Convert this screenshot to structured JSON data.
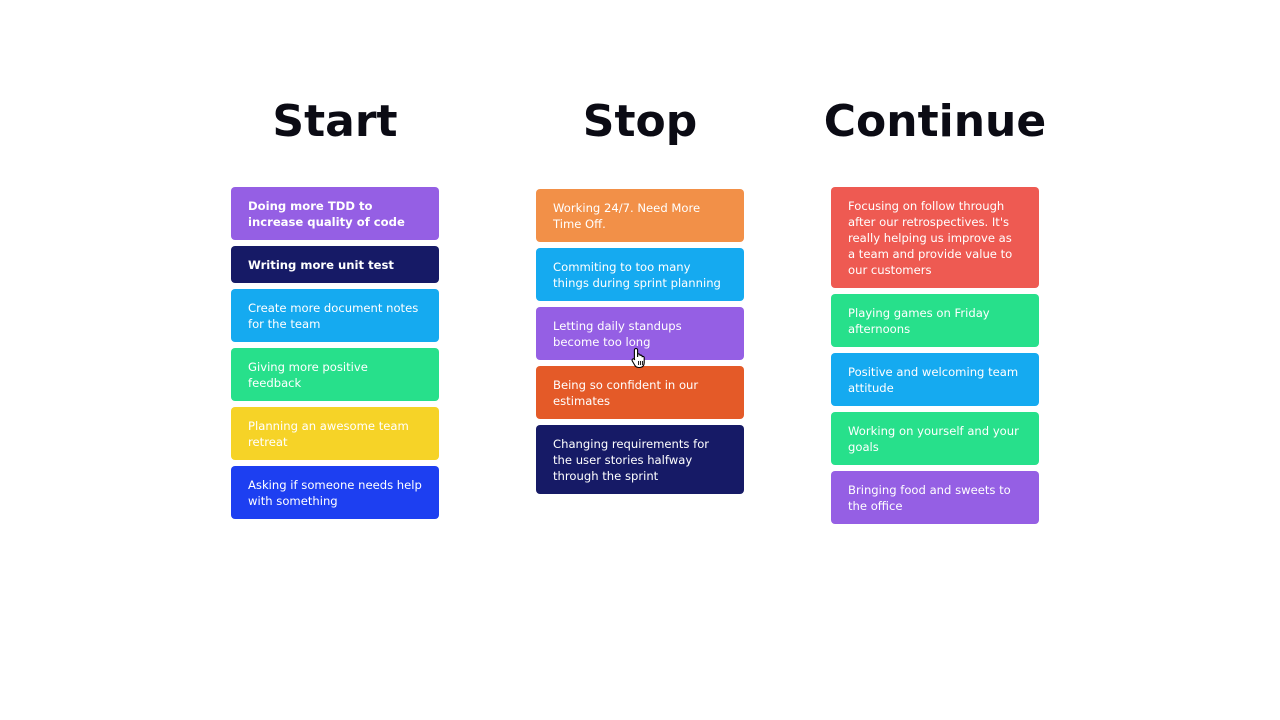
{
  "columns": [
    {
      "title": "Start",
      "cards": [
        {
          "text": "Doing more TDD to increase quality of code",
          "color": "#955fe4"
        },
        {
          "text": "Writing more unit test",
          "color": "#161a66"
        },
        {
          "text": "Create more document notes for the team",
          "color": "#15aaf0"
        },
        {
          "text": "Giving more positive feedback",
          "color": "#27e08b"
        },
        {
          "text": "Planning an awesome team retreat",
          "color": "#f6d327"
        },
        {
          "text": "Asking if someone needs help with something",
          "color": "#1d3ff1"
        }
      ]
    },
    {
      "title": "Stop",
      "cards": [
        {
          "text": "Working 24/7. Need More Time Off.",
          "color": "#f29048"
        },
        {
          "text": "Commiting to too many things during sprint planning",
          "color": "#15aaf0"
        },
        {
          "text": "Letting daily standups become too long",
          "color": "#955fe4"
        },
        {
          "text": "Being so confident in our estimates",
          "color": "#e45a28"
        },
        {
          "text": "Changing requirements for the user stories halfway through the sprint",
          "color": "#161a66"
        }
      ]
    },
    {
      "title": "Continue",
      "cards": [
        {
          "text": "Focusing on follow through after our retrospectives. It's really helping us improve as a team and provide value to our customers",
          "color": "#ee5a52"
        },
        {
          "text": "Playing games on Friday afternoons",
          "color": "#27e08b"
        },
        {
          "text": "Positive and welcoming team attitude",
          "color": "#15aaf0"
        },
        {
          "text": "Working on yourself and your goals",
          "color": "#27e08b"
        },
        {
          "text": "Bringing food and sweets to the office",
          "color": "#955fe4"
        }
      ]
    }
  ],
  "cursor": {
    "icon": "hand-pointer-icon"
  }
}
